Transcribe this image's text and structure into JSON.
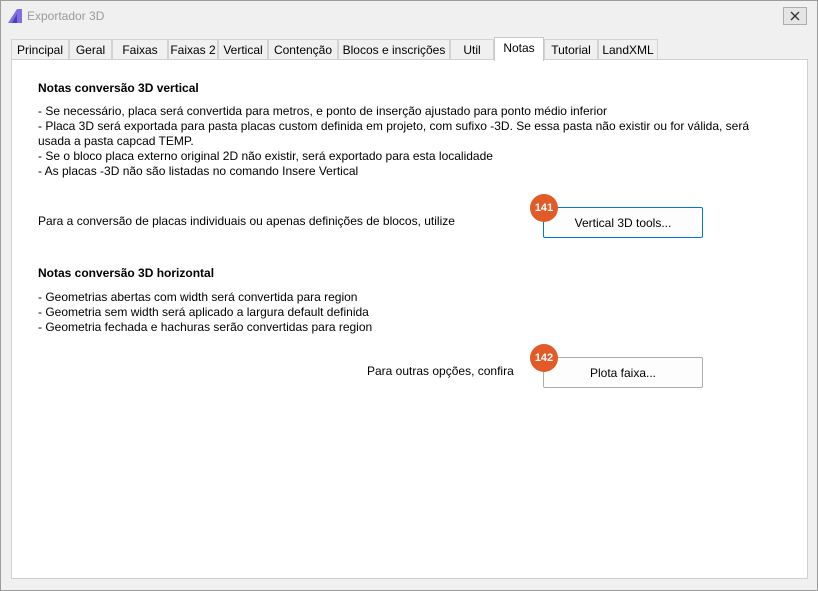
{
  "window": {
    "title": "Exportador 3D"
  },
  "tabs": [
    {
      "label": "Principal"
    },
    {
      "label": "Geral"
    },
    {
      "label": "Faixas"
    },
    {
      "label": "Faixas 2"
    },
    {
      "label": "Vertical"
    },
    {
      "label": "Contenção"
    },
    {
      "label": "Blocos e inscrições"
    },
    {
      "label": "Util"
    },
    {
      "label": "Notas"
    },
    {
      "label": "Tutorial"
    },
    {
      "label": "LandXML"
    }
  ],
  "active_tab": "Notas",
  "vertical": {
    "heading": "Notas conversão 3D vertical",
    "lines": [
      "- Se necessário, placa será convertida para metros, e ponto de inserção ajustado para ponto médio inferior",
      "- Placa 3D será exportada para pasta placas custom definida em projeto, com sufixo -3D. Se essa pasta não existir ou for válida, será",
      "usada a pasta capcad TEMP.",
      "- Se o bloco placa externo original 2D não existir, será exportado para esta localidade",
      "- As placas -3D não são listadas no comando Insere Vertical"
    ],
    "prompt": "Para a conversão de placas individuais ou apenas definições de blocos, utilize",
    "button_label": "Vertical 3D tools...",
    "badge": "141"
  },
  "horizontal": {
    "heading": "Notas conversão 3D horizontal",
    "lines": [
      "- Geometrias abertas com width será convertida para region",
      "- Geometria sem width será aplicado a largura default definida",
      "- Geometria fechada e hachuras serão convertidas para region"
    ],
    "prompt": "Para outras opções, confira",
    "button_label": "Plota faixa...",
    "badge": "142"
  },
  "colors": {
    "accent": "#0078d7",
    "badge": "#e15a28",
    "title_text": "#9a9a9a"
  }
}
